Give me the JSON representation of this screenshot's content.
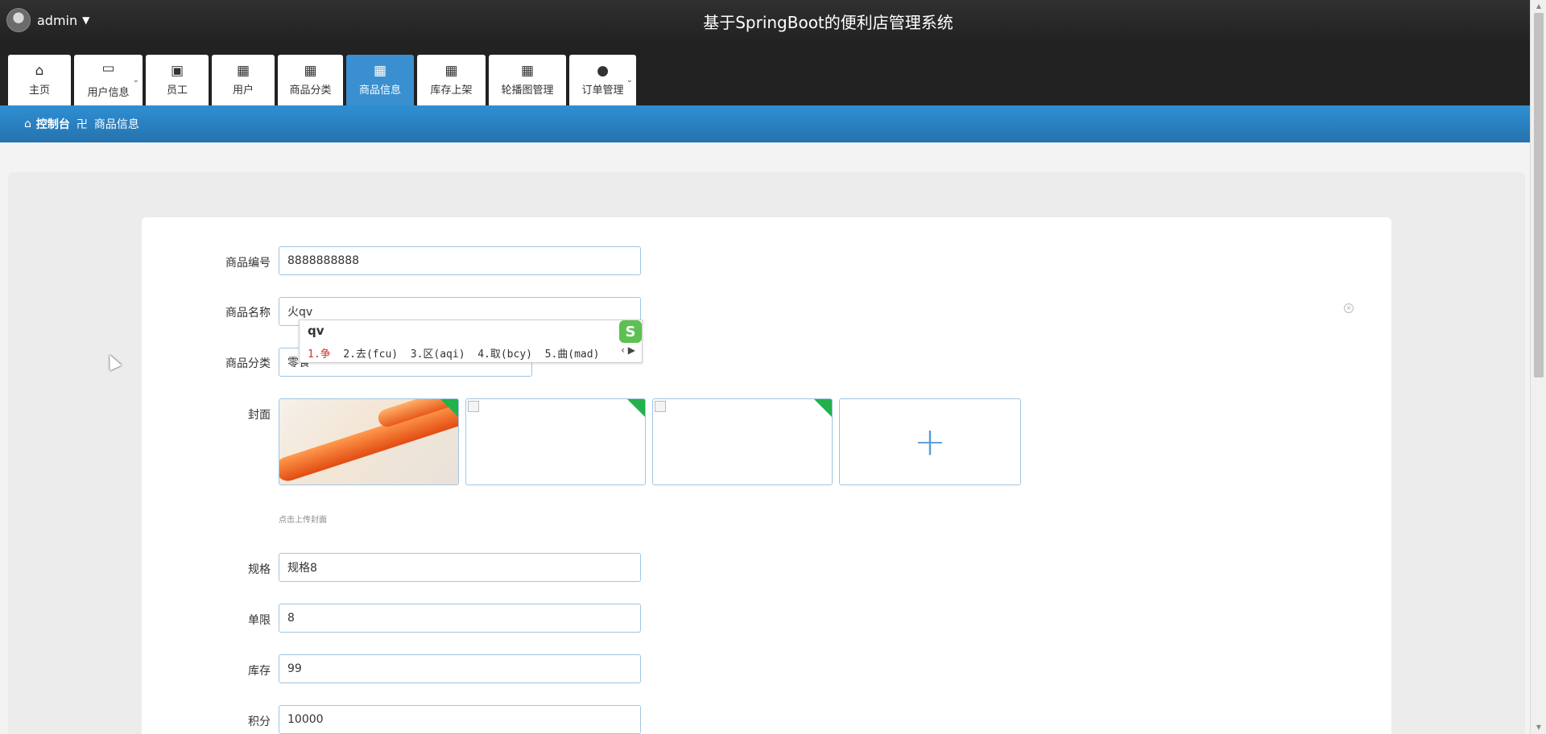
{
  "header": {
    "user": "admin",
    "title": "基于SpringBoot的便利店管理系统"
  },
  "nav": {
    "tabs": [
      {
        "label": "主页",
        "icon": "home-icon",
        "glyph": "⌂"
      },
      {
        "label": "用户信息",
        "icon": "wallet-icon",
        "glyph": "▭",
        "dropdown": true
      },
      {
        "label": "员工",
        "icon": "briefcase-icon",
        "glyph": "▣"
      },
      {
        "label": "用户",
        "icon": "grid-icon",
        "glyph": "▦"
      },
      {
        "label": "商品分类",
        "icon": "grid-icon",
        "glyph": "▦"
      },
      {
        "label": "商品信息",
        "icon": "grid-icon",
        "glyph": "▦",
        "active": true
      },
      {
        "label": "库存上架",
        "icon": "grid-icon",
        "glyph": "▦"
      },
      {
        "label": "轮播图管理",
        "icon": "grid-icon",
        "glyph": "▦"
      },
      {
        "label": "订单管理",
        "icon": "user-icon",
        "glyph": "●",
        "dropdown": true
      }
    ]
  },
  "breadcrumb": {
    "home": "控制台",
    "separator": "卍",
    "current": "商品信息"
  },
  "form": {
    "code_label": "商品编号",
    "code_value": "8888888888",
    "name_label": "商品名称",
    "name_value": "火qv",
    "category_label": "商品分类",
    "category_value": "零食",
    "cover_label": "封面",
    "cover_hint": "点击上传封面",
    "spec_label": "规格",
    "spec_value": "规格8",
    "limit_label": "单限",
    "limit_value": "8",
    "stock_label": "库存",
    "stock_value": "99",
    "points_label": "积分",
    "points_value": "10000"
  },
  "ime": {
    "composition": "qv",
    "candidates": "1.争  2.去(fcu)  3.区(aqi)  4.取(bcy)  5.曲(mad)",
    "first": "1.争"
  },
  "colors": {
    "accent": "#3a8fd1",
    "topbar": "#222222",
    "input_border": "#9fc6e3"
  }
}
